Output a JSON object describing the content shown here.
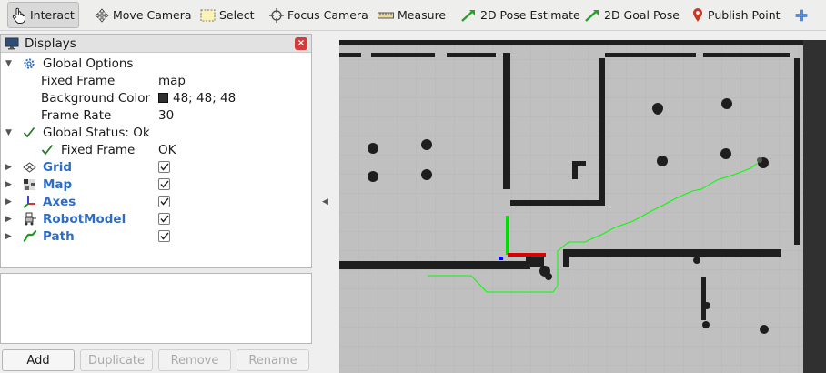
{
  "toolbar": {
    "interact": "Interact",
    "move_camera": "Move Camera",
    "select": "Select",
    "focus_camera": "Focus Camera",
    "measure": "Measure",
    "pose_estimate": "2D Pose Estimate",
    "goal_pose": "2D Goal Pose",
    "publish_point": "Publish Point"
  },
  "displays_panel": {
    "title": "Displays",
    "global_options": {
      "label": "Global Options",
      "fixed_frame_label": "Fixed Frame",
      "fixed_frame_value": "map",
      "background_color_label": "Background Color",
      "background_color_value": "48; 48; 48",
      "background_color_hex": "#303030",
      "frame_rate_label": "Frame Rate",
      "frame_rate_value": "30"
    },
    "global_status": {
      "label": "Global Status: Ok",
      "fixed_frame_label": "Fixed Frame",
      "fixed_frame_value": "OK"
    },
    "displays": [
      {
        "name": "Grid",
        "icon": "grid-icon",
        "checked": true
      },
      {
        "name": "Map",
        "icon": "map-icon",
        "checked": true
      },
      {
        "name": "Axes",
        "icon": "axes-icon",
        "checked": true
      },
      {
        "name": "RobotModel",
        "icon": "robot-icon",
        "checked": true
      },
      {
        "name": "Path",
        "icon": "path-icon",
        "checked": true
      }
    ]
  },
  "buttons": {
    "add": "Add",
    "duplicate": "Duplicate",
    "remove": "Remove",
    "rename": "Rename"
  },
  "colors": {
    "accent_blue": "#2f6dc4",
    "path_green": "#00ff00",
    "map_free": "#c0c0c0",
    "map_wall": "#1e1e1e"
  }
}
